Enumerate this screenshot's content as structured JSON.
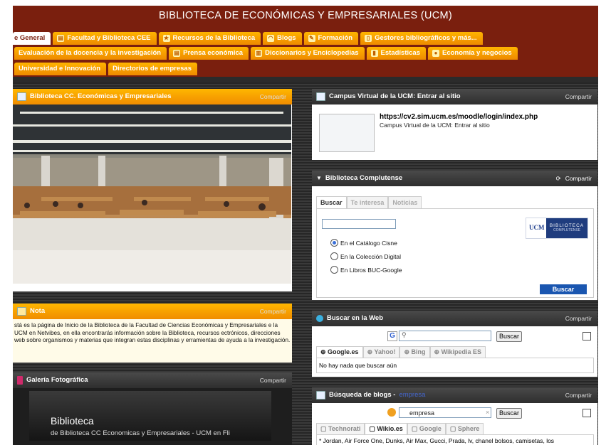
{
  "site_title": "BIBLIOTECA DE ECONÓMICAS Y EMPRESARIALES (UCM)",
  "tabs_row1": [
    {
      "label": "e General",
      "active": true
    },
    {
      "label": "Facultad y Biblioteca CEE"
    },
    {
      "label": "Recursos de la Biblioteca"
    },
    {
      "label": "Blogs"
    },
    {
      "label": "Formación"
    },
    {
      "label": "Gestores bibliográficos y más..."
    }
  ],
  "tabs_row2": [
    {
      "label": "Evaluación de la docencia y la investigación"
    },
    {
      "label": "Prensa económica"
    },
    {
      "label": "Diccionarios y Enciclopedias"
    },
    {
      "label": "Estadísticas"
    },
    {
      "label": "Economía y negocios"
    }
  ],
  "tabs_row3": [
    {
      "label": "Universidad e Innovación"
    },
    {
      "label": "Directorios de empresas"
    }
  ],
  "share_label": "Compartir",
  "widget_biblioteca": {
    "title": "Biblioteca CC. Económicas y Empresariales"
  },
  "widget_nota": {
    "title": "Nota",
    "text": "stá es la página de Inicio de la Biblioteca de la Facultad de Ciencias Económicas y Empresariales e la UCM en Netvibes, en ella encontrarás información sobre la Biblioteca, recursos ectrónicos, direcciones web sobre organismos y materias que integran estas disciplinas y erramientas de ayuda a la investigación."
  },
  "widget_galeria": {
    "title": "Galería Fotográfica",
    "image_title": "Biblioteca",
    "image_subtitle": "de Biblioteca CC Economicas y Empresariales - UCM en Fli"
  },
  "widget_campus": {
    "title": "Campus Virtual de la UCM: Entrar al sitio",
    "url": "https://cv2.sim.ucm.es/moodle/login/index.php",
    "desc": "Campus Virtual de la UCM: Entrar al sitio"
  },
  "widget_complutense": {
    "title": "Biblioteca Complutense",
    "tabs": [
      "Buscar",
      "Te interesa",
      "Noticias"
    ],
    "search_value": "",
    "options": [
      "En el Catálogo Cisne",
      "En la Colección Digital",
      "En Libros BUC-Google"
    ],
    "selected_option": 0,
    "logo_text": "UCM",
    "logo_sub1": "BIBLIOTECA",
    "logo_sub2": "COMPLUTENSE",
    "button": "Buscar"
  },
  "widget_web": {
    "title": "Buscar en la Web",
    "search_value": "",
    "button": "Buscar",
    "tabs": [
      "Google.es",
      "Yahoo!",
      "Bing",
      "Wikipedia ES"
    ],
    "result": "No hay nada que buscar aún"
  },
  "widget_blogs": {
    "title": "Búsqueda de blogs -",
    "title_suffix": "empresa",
    "search_value": "empresa",
    "button": "Buscar",
    "tabs": [
      "Technorati",
      "Wikio.es",
      "Google",
      "Sphere"
    ],
    "result": "* Jordan, Air Force One, Dunks, Air Max, Gucci, Prada, lv, chanel bolsos, camisetas, los"
  }
}
